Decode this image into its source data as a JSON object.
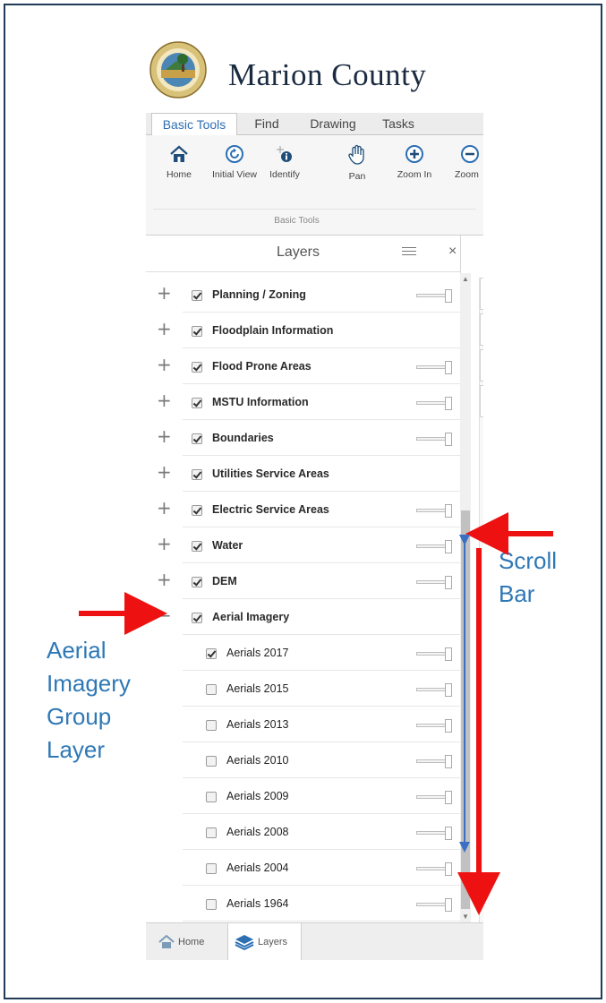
{
  "app": {
    "title": "Marion County",
    "logo": "marion-county-seal",
    "accent_color": "#2d6fb3"
  },
  "ribbon": {
    "tabs": [
      {
        "label": "Basic Tools",
        "active": true
      },
      {
        "label": "Find",
        "active": false
      },
      {
        "label": "Drawing",
        "active": false
      },
      {
        "label": "Tasks",
        "active": false
      }
    ],
    "tools": [
      {
        "label": "Home",
        "icon": "home-icon"
      },
      {
        "label": "Initial View",
        "icon": "initial-view-icon"
      },
      {
        "label": "Identify",
        "icon": "identify-icon"
      },
      {
        "label": "Pan",
        "icon": "pan-hand-icon"
      },
      {
        "label": "Zoom In",
        "icon": "zoom-in-icon"
      },
      {
        "label": "Zoom",
        "icon": "zoom-out-icon"
      }
    ],
    "group_label": "Basic Tools"
  },
  "layers_panel": {
    "title": "Layers",
    "layers": [
      {
        "label": "Planning / Zoning",
        "expander": "+",
        "checked": true,
        "level": 0,
        "slider": true
      },
      {
        "label": "Floodplain Information",
        "expander": "+",
        "checked": true,
        "level": 0,
        "slider": false
      },
      {
        "label": "Flood Prone Areas",
        "expander": "+",
        "checked": true,
        "level": 0,
        "slider": true
      },
      {
        "label": "MSTU Information",
        "expander": "+",
        "checked": true,
        "level": 0,
        "slider": true
      },
      {
        "label": "Boundaries",
        "expander": "+",
        "checked": true,
        "level": 0,
        "slider": true
      },
      {
        "label": "Utilities Service Areas",
        "expander": "+",
        "checked": true,
        "level": 0,
        "slider": false
      },
      {
        "label": "Electric Service Areas",
        "expander": "+",
        "checked": true,
        "level": 0,
        "slider": true
      },
      {
        "label": "Water",
        "expander": "+",
        "checked": true,
        "level": 0,
        "slider": true
      },
      {
        "label": "DEM",
        "expander": "+",
        "checked": true,
        "level": 0,
        "slider": true
      },
      {
        "label": "Aerial Imagery",
        "expander": "−",
        "checked": true,
        "level": 0,
        "slider": false
      },
      {
        "label": "Aerials 2017",
        "expander": "",
        "checked": true,
        "level": 1,
        "slider": true
      },
      {
        "label": "Aerials 2015",
        "expander": "",
        "checked": false,
        "level": 1,
        "slider": true
      },
      {
        "label": "Aerials 2013",
        "expander": "",
        "checked": false,
        "level": 1,
        "slider": true
      },
      {
        "label": "Aerials 2010",
        "expander": "",
        "checked": false,
        "level": 1,
        "slider": true
      },
      {
        "label": "Aerials 2009",
        "expander": "",
        "checked": false,
        "level": 1,
        "slider": true
      },
      {
        "label": "Aerials 2008",
        "expander": "",
        "checked": false,
        "level": 1,
        "slider": true
      },
      {
        "label": "Aerials 2004",
        "expander": "",
        "checked": false,
        "level": 1,
        "slider": true
      },
      {
        "label": "Aerials 1964",
        "expander": "",
        "checked": false,
        "level": 1,
        "slider": true
      }
    ]
  },
  "bottom_tabs": [
    {
      "label": "Home",
      "icon": "home-icon",
      "active": false
    },
    {
      "label": "Layers",
      "icon": "layers-icon",
      "active": true
    }
  ],
  "annotations": {
    "scroll_bar": [
      "Scroll",
      "Bar"
    ],
    "group_layer": [
      "Aerial",
      "Imagery",
      "Group",
      "Layer"
    ],
    "arrow_color": "#ee1111",
    "text_color": "#2f78b6"
  }
}
